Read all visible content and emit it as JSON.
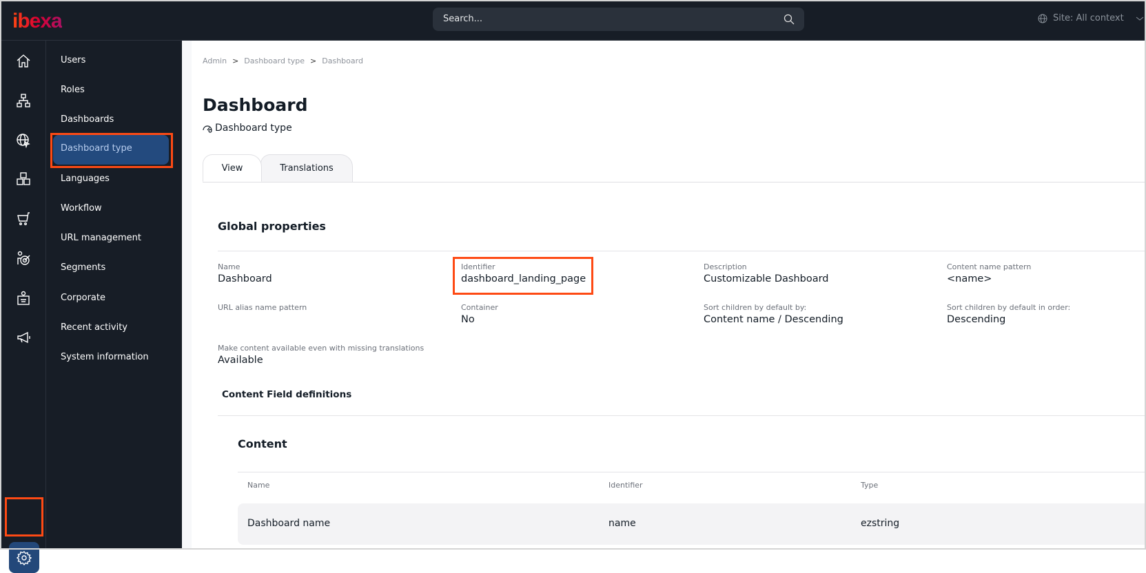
{
  "topbar": {
    "logo": "ibexa",
    "search_placeholder": "Search...",
    "site_context": "Site: All context"
  },
  "rail": {
    "icons": [
      "home-icon",
      "sitemap-icon",
      "globe-cursor-icon",
      "boxes-icon",
      "cart-icon",
      "target-user-icon",
      "corporate-icon",
      "megaphone-icon"
    ],
    "settings": "gear-icon"
  },
  "submenu": {
    "items": [
      "Users",
      "Roles",
      "Dashboards",
      "Dashboard type",
      "Languages",
      "Workflow",
      "URL management",
      "Segments",
      "Corporate",
      "Recent activity",
      "System information"
    ],
    "active": "Dashboard type"
  },
  "breadcrumb": [
    "Admin",
    "Dashboard type",
    "Dashboard"
  ],
  "breadcrumb_sep": ">",
  "page": {
    "title": "Dashboard",
    "subtitle": "Dashboard type"
  },
  "tabs": [
    "View",
    "Translations"
  ],
  "global": {
    "heading": "Global properties",
    "fields": [
      {
        "label": "Name",
        "value": "Dashboard"
      },
      {
        "label": "Identifier",
        "value": "dashboard_landing_page"
      },
      {
        "label": "Description",
        "value": "Customizable Dashboard"
      },
      {
        "label": "Content name pattern",
        "value": "<name>"
      },
      {
        "label": "URL alias name pattern",
        "value": ""
      },
      {
        "label": "Container",
        "value": "No"
      },
      {
        "label": "Sort children by default by:",
        "value": "Content name / Descending"
      },
      {
        "label": "Sort children by default in order:",
        "value": "Descending"
      },
      {
        "label": "Make content available even with missing translations",
        "value": "Available"
      }
    ]
  },
  "fielddefs": {
    "heading": "Content Field definitions",
    "group": "Content",
    "columns": [
      "Name",
      "Identifier",
      "Type"
    ],
    "rows": [
      [
        "Dashboard name",
        "name",
        "ezstring"
      ]
    ]
  },
  "colors": {
    "highlight": "#fe4a14",
    "active_bg": "#234a7e",
    "dark_bg": "#171d26"
  }
}
